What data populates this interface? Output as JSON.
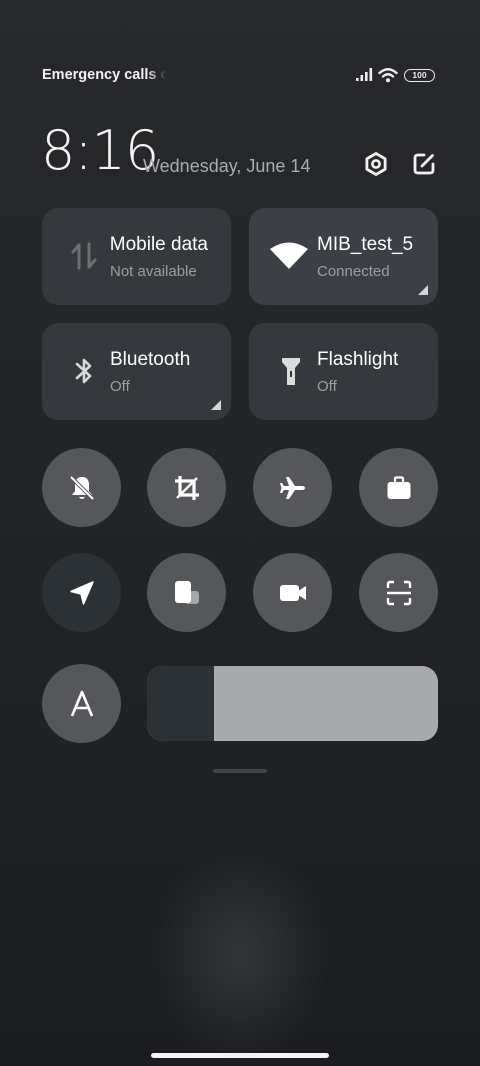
{
  "status_bar": {
    "carrier_text": "Emergency calls o",
    "battery_level": "100"
  },
  "header": {
    "time": "8:16",
    "date": "Wednesday, June 14",
    "settings_icon": "settings-hex-icon",
    "edit_icon": "edit-icon"
  },
  "tiles": [
    {
      "title": "Mobile data",
      "subtitle": "Not available",
      "icon": "mobile-data-icon",
      "active": false
    },
    {
      "title": "MIB_test_5",
      "subtitle": "Connected",
      "icon": "wifi-icon",
      "active": true
    },
    {
      "title": "Bluetooth",
      "subtitle": "Off",
      "icon": "bluetooth-icon",
      "active": false
    },
    {
      "title": "Flashlight",
      "subtitle": "Off",
      "icon": "flashlight-icon",
      "active": false
    }
  ],
  "toggles": [
    {
      "name": "mute",
      "icon": "bell-off-icon"
    },
    {
      "name": "screenshot",
      "icon": "crop-icon"
    },
    {
      "name": "airplane-mode",
      "icon": "airplane-icon"
    },
    {
      "name": "work",
      "icon": "briefcase-icon"
    },
    {
      "name": "location",
      "icon": "location-arrow-icon",
      "active": true
    },
    {
      "name": "floating-window",
      "icon": "floating-window-icon"
    },
    {
      "name": "screen-recorder",
      "icon": "video-camera-icon"
    },
    {
      "name": "scanner",
      "icon": "scan-icon"
    },
    {
      "name": "auto-brightness",
      "icon": "auto-brightness-icon",
      "label": "A"
    }
  ],
  "brightness": {
    "level": 0.23
  },
  "colors": {
    "tile": "#35383c",
    "toggle": "#55575a",
    "active_dark": "#2c3136",
    "slider_track": "#a9aaab"
  }
}
